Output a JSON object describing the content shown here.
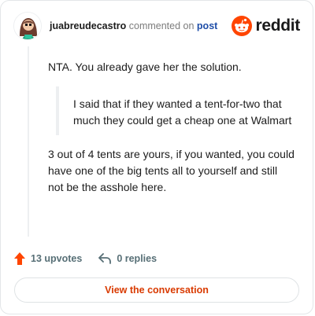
{
  "comment": {
    "author": "juabreudecastro",
    "action_text": "commented on",
    "target_text": "post",
    "paragraph_1": "NTA. You already gave her the solution.",
    "quote": "I said that if they wanted a tent-for-two that much they could get a cheap one at Walmart",
    "paragraph_2": "3 out of 4 tents are yours, if you wanted, you could have one of the big tents all to yourself and still not be the asshole here."
  },
  "brand": {
    "wordmark": "reddit",
    "accent_color": "#ff4500"
  },
  "stats": {
    "upvotes": "13 upvotes",
    "replies": "0 replies"
  },
  "cta": {
    "label": "View the conversation",
    "color": "#d93a00"
  },
  "icons": {
    "avatar": "avatar-icon",
    "upvote": "upvote-arrow-icon",
    "reply": "reply-arrow-icon",
    "logo": "reddit-snoo-icon"
  }
}
